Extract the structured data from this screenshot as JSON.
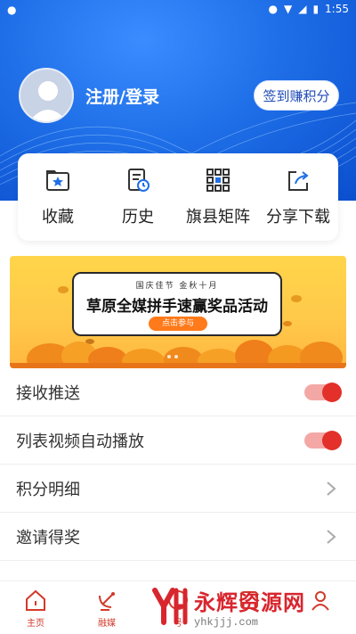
{
  "status_bar": {
    "time": "1:55"
  },
  "profile": {
    "login_label": "注册/登录",
    "signin_button": "签到赚积分"
  },
  "quick_actions": [
    {
      "label": "收藏",
      "icon": "folder-star-icon"
    },
    {
      "label": "历史",
      "icon": "history-doc-icon"
    },
    {
      "label": "旗县矩阵",
      "icon": "grid-matrix-icon"
    },
    {
      "label": "分享下载",
      "icon": "share-icon"
    }
  ],
  "banner": {
    "subtitle": "国庆佳节  金秋十月",
    "title": "草原全媒拼手速赢奖品活动",
    "button": "点击参与"
  },
  "settings": [
    {
      "label": "接收推送",
      "type": "toggle",
      "on": true
    },
    {
      "label": "列表视频自动播放",
      "type": "toggle",
      "on": true
    },
    {
      "label": "积分明细",
      "type": "link"
    },
    {
      "label": "邀请得奖",
      "type": "link"
    }
  ],
  "tabbar": [
    {
      "label": "主页",
      "icon": "home-icon"
    },
    {
      "label": "融媒",
      "icon": "satellite-icon"
    },
    {
      "label": "号",
      "icon": "account-icon"
    },
    {
      "label": "",
      "icon": "tab-icon"
    },
    {
      "label": "",
      "icon": "profile-icon"
    }
  ],
  "watermark": {
    "title": "永辉资源网",
    "url": "yhkjjj.com"
  },
  "colors": {
    "primary_blue": "#1f6fe8",
    "accent_red": "#e3302a",
    "banner_yellow": "#ffc84a"
  }
}
